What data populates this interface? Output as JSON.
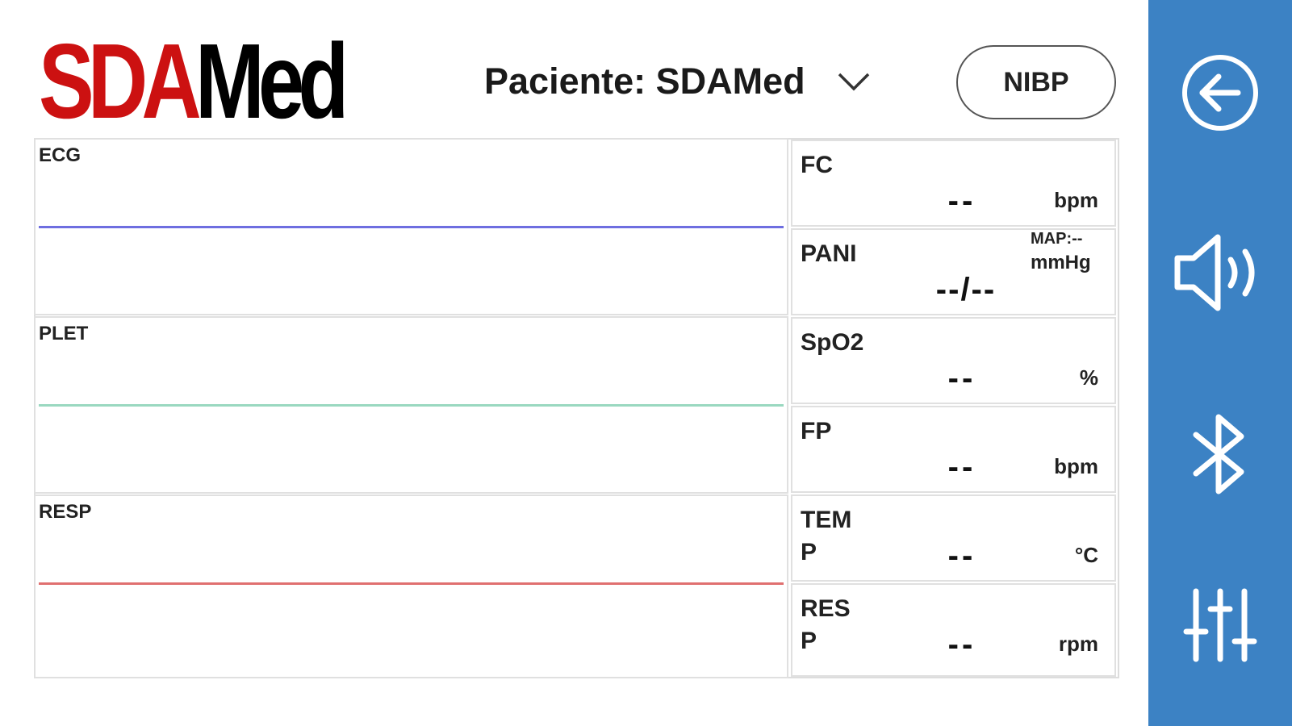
{
  "logo": {
    "part1": "SDA",
    "part2": "Med"
  },
  "header": {
    "patient_label": "Paciente: SDAMed",
    "nibp_button": "NIBP"
  },
  "waves": [
    {
      "label": "ECG",
      "color": "#6e6ee0"
    },
    {
      "label": "PLET",
      "color": "#9ad8c0"
    },
    {
      "label": "RESP",
      "color": "#e07070"
    }
  ],
  "vitals": {
    "fc": {
      "name": "FC",
      "value": "--",
      "unit": "bpm"
    },
    "pani": {
      "name": "PANI",
      "value": "--/--",
      "map": "MAP:--",
      "unit": "mmHg"
    },
    "spo2": {
      "name": "SpO2",
      "value": "--",
      "unit": "%"
    },
    "fp": {
      "name": "FP",
      "value": "--",
      "unit": "bpm"
    },
    "temp": {
      "name": "TEMP",
      "value": "--",
      "unit": "°C"
    },
    "resp": {
      "name": "RESP",
      "value": "--",
      "unit": "rpm"
    }
  },
  "sidebar": {
    "color": "#3c82c4",
    "items": [
      "back-icon",
      "speaker-icon",
      "bluetooth-icon",
      "sliders-icon"
    ]
  }
}
